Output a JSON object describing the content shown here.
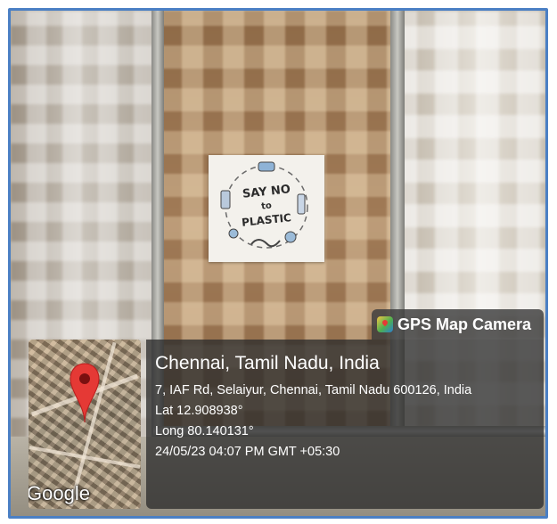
{
  "poster": {
    "line1": "SAY NO",
    "line2": "to",
    "line3": "PLASTIC"
  },
  "overlay": {
    "app_name": "GPS Map Camera",
    "app_icon": "gps-map-camera-icon",
    "place": "Chennai, Tamil Nadu, India",
    "address": "7, IAF Rd, Selaiyur, Chennai, Tamil Nadu 600126, India",
    "latitude": "Lat 12.908938°",
    "longitude": "Long 80.140131°",
    "timestamp": "24/05/23 04:07 PM GMT +05:30",
    "map_label": "Google",
    "pin_icon": "map-pin-icon",
    "pin_color": "#e53935"
  },
  "colors": {
    "frame_border": "#4a7fc4",
    "overlay_bg": "#2d2d2d"
  }
}
